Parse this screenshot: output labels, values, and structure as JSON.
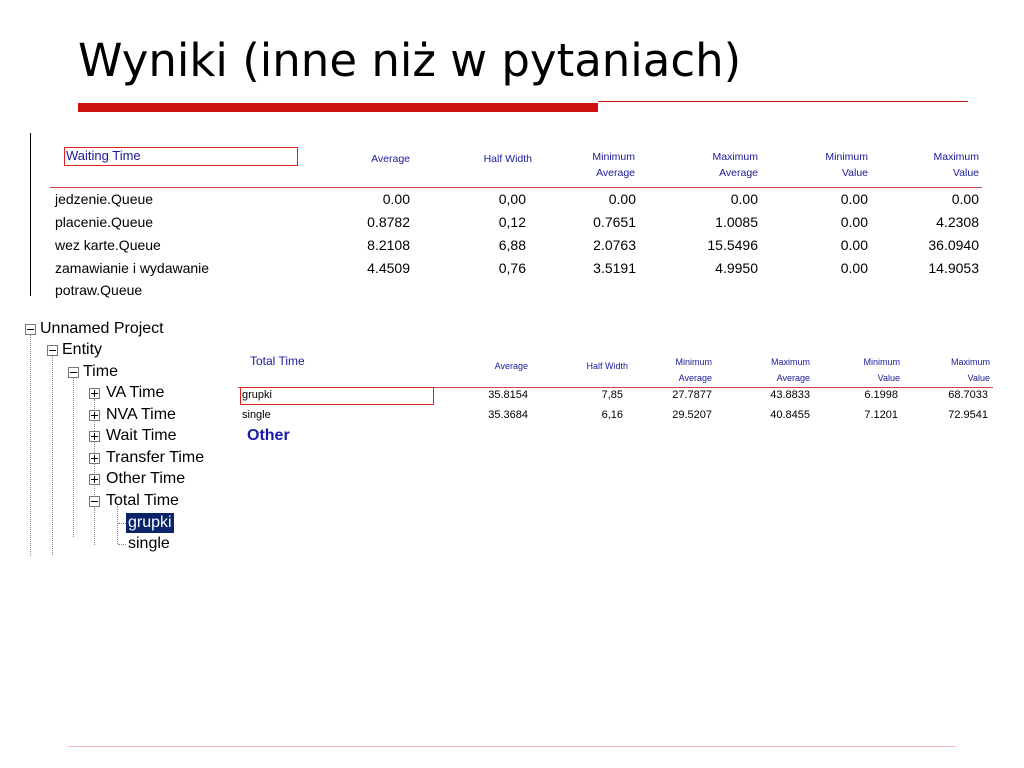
{
  "slide": {
    "title": "Wyniki (inne niż w pytaniach)"
  },
  "waiting_time": {
    "title": "Waiting Time",
    "headers": [
      {
        "line1": "",
        "line2": "Average"
      },
      {
        "line1": "",
        "line2": "Half Width"
      },
      {
        "line1": "Minimum",
        "line2": "Average"
      },
      {
        "line1": "Maximum",
        "line2": "Average"
      },
      {
        "line1": "Minimum",
        "line2": "Value"
      },
      {
        "line1": "Maximum",
        "line2": "Value"
      }
    ],
    "rows": [
      {
        "name": "jedzenie.Queue",
        "average": "0.00",
        "half_width": "0,00",
        "min_avg": "0.00",
        "max_avg": "0.00",
        "min_val": "0.00",
        "max_val": "0.00"
      },
      {
        "name": "placenie.Queue",
        "average": "0.8782",
        "half_width": "0,12",
        "min_avg": "0.7651",
        "max_avg": "1.0085",
        "min_val": "0.00",
        "max_val": "4.2308"
      },
      {
        "name": "wez karte.Queue",
        "average": "8.2108",
        "half_width": "6,88",
        "min_avg": "2.0763",
        "max_avg": "15.5496",
        "min_val": "0.00",
        "max_val": "36.0940"
      },
      {
        "name": "zamawianie i wydawanie",
        "name2": "potraw.Queue",
        "average": "4.4509",
        "half_width": "0,76",
        "min_avg": "3.5191",
        "max_avg": "4.9950",
        "min_val": "0.00",
        "max_val": "14.9053"
      }
    ]
  },
  "tree": {
    "root": "Unnamed Project",
    "entity": "Entity",
    "time": "Time",
    "items": [
      "VA Time",
      "NVA Time",
      "Wait Time",
      "Transfer Time",
      "Other Time",
      "Total Time"
    ],
    "children": [
      "grupki",
      "single"
    ]
  },
  "total_time": {
    "title": "Total Time",
    "headers": [
      {
        "line1": "",
        "line2": "Average"
      },
      {
        "line1": "",
        "line2": "Half Width"
      },
      {
        "line1": "Minimum",
        "line2": "Average"
      },
      {
        "line1": "Maximum",
        "line2": "Average"
      },
      {
        "line1": "Minimum",
        "line2": "Value"
      },
      {
        "line1": "Maximum",
        "line2": "Value"
      }
    ],
    "rows": [
      {
        "name": "grupki",
        "average": "35.8154",
        "half_width": "7,85",
        "min_avg": "27.7877",
        "max_avg": "43.8833",
        "min_val": "6.1998",
        "max_val": "68.7033"
      },
      {
        "name": "single",
        "average": "35.3684",
        "half_width": "6,16",
        "min_avg": "29.5207",
        "max_avg": "40.8455",
        "min_val": "7.1201",
        "max_val": "72.9541"
      }
    ]
  },
  "other_label": "Other",
  "colors": {
    "accent_red": "#cc1111",
    "header_blue": "#1a1a9a",
    "selection": "#0a246a"
  }
}
